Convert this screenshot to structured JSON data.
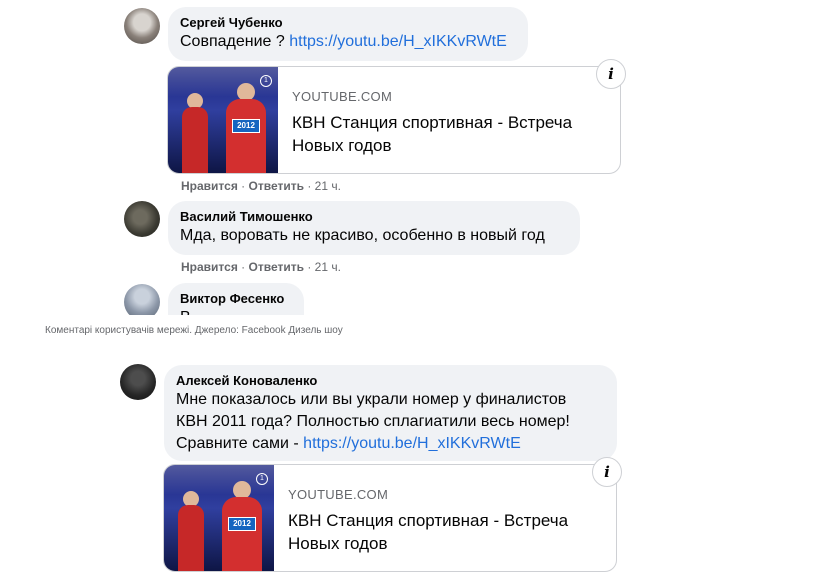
{
  "caption": "Коментарі користувачів мережі. Джерело: Facebook Дизель шоу",
  "comments": [
    {
      "author": "Сергей Чубенко",
      "text": "Совпадение ? ",
      "link": "https://youtu.be/H_xIKKvRWtE",
      "card": {
        "source": "YOUTUBE.COM",
        "title": "КВН Станция спортивная - Встреча Новых годов",
        "plate": "2012"
      },
      "actions": {
        "like": "Нравится",
        "reply": "Ответить",
        "time": "21 ч."
      }
    },
    {
      "author": "Василий Тимошенко",
      "text": "Мда, воровать не красиво, особенно в новый год",
      "actions": {
        "like": "Нравится",
        "reply": "Ответить",
        "time": "21 ч."
      }
    },
    {
      "author": "Виктор Фесенко",
      "text": "В"
    },
    {
      "author": "Алексей Коноваленко",
      "lines": [
        "Мне показалось или вы украли номер у финалистов",
        "КВН 2011 года? Полностью сплагиатили весь номер!",
        "Сравните сами - "
      ],
      "link": "https://youtu.be/H_xIKKvRWtE",
      "card": {
        "source": "YOUTUBE.COM",
        "title": "КВН Станция спортивная - Встреча Новых годов",
        "plate": "2012"
      }
    }
  ],
  "separator": "·",
  "info_glyph": "i"
}
